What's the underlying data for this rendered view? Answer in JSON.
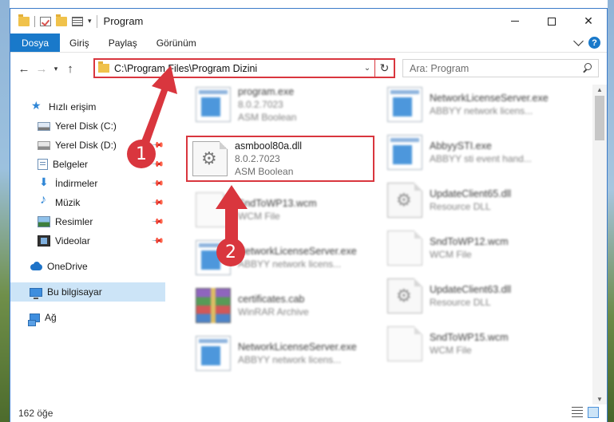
{
  "window": {
    "title": "Program"
  },
  "ribbon": {
    "tabs": [
      "Dosya",
      "Giriş",
      "Paylaş",
      "Görünüm"
    ]
  },
  "address": {
    "path": "C:\\Program Files\\Program Dizini"
  },
  "search": {
    "placeholder": "Ara: Program"
  },
  "sidebar": {
    "items": [
      {
        "label": "Hızlı erişim",
        "icon": "star-icon"
      },
      {
        "label": "Yerel Disk (C:)",
        "icon": "windows-drive-icon"
      },
      {
        "label": "Yerel Disk (D:)",
        "icon": "drive-icon"
      },
      {
        "label": "Belgeler",
        "icon": "documents-icon"
      },
      {
        "label": "İndirmeler",
        "icon": "downloads-icon"
      },
      {
        "label": "Müzik",
        "icon": "music-icon"
      },
      {
        "label": "Resimler",
        "icon": "pictures-icon"
      },
      {
        "label": "Videolar",
        "icon": "videos-icon"
      },
      {
        "label": "OneDrive",
        "icon": "cloud-icon"
      },
      {
        "label": "Bu bilgisayar",
        "icon": "computer-icon"
      },
      {
        "label": "Ağ",
        "icon": "network-icon"
      }
    ]
  },
  "files": {
    "left": [
      {
        "name": "program.exe",
        "sub1": "8.0.2.7023",
        "sub2": "ASM Boolean",
        "icon": "exe-file-icon"
      },
      {
        "name": "asmbool80a.dll",
        "sub1": "8.0.2.7023",
        "sub2": "ASM Boolean",
        "icon": "dll-file-icon"
      },
      {
        "name": "SndToWP13.wcm",
        "sub1": "WCM File",
        "sub2": "",
        "icon": "blank-file-icon"
      },
      {
        "name": "NetworkLicenseServer.exe",
        "sub1": "ABBYY network licens...",
        "sub2": "",
        "icon": "exe-file-icon"
      },
      {
        "name": "certificates.cab",
        "sub1": "WinRAR Archive",
        "sub2": "",
        "icon": "archive-file-icon"
      },
      {
        "name": "NetworkLicenseServer.exe",
        "sub1": "ABBYY network licens...",
        "sub2": "",
        "icon": "exe-file-icon"
      }
    ],
    "right": [
      {
        "name": "NetworkLicenseServer.exe",
        "sub1": "ABBYY network licens...",
        "icon": "exe-file-icon"
      },
      {
        "name": "AbbyySTI.exe",
        "sub1": "ABBYY sti event hand...",
        "icon": "exe-file-icon"
      },
      {
        "name": "UpdateClient65.dll",
        "sub1": "Resource DLL",
        "icon": "dll-file-icon"
      },
      {
        "name": "SndToWP12.wcm",
        "sub1": "WCM File",
        "icon": "blank-file-icon"
      },
      {
        "name": "UpdateClient63.dll",
        "sub1": "Resource DLL",
        "icon": "dll-file-icon"
      },
      {
        "name": "SndToWP15.wcm",
        "sub1": "WCM File",
        "icon": "blank-file-icon"
      }
    ]
  },
  "status": {
    "count": "162 öğe"
  },
  "annotations": {
    "badge1": "1",
    "badge2": "2",
    "color": "#d9363e"
  }
}
